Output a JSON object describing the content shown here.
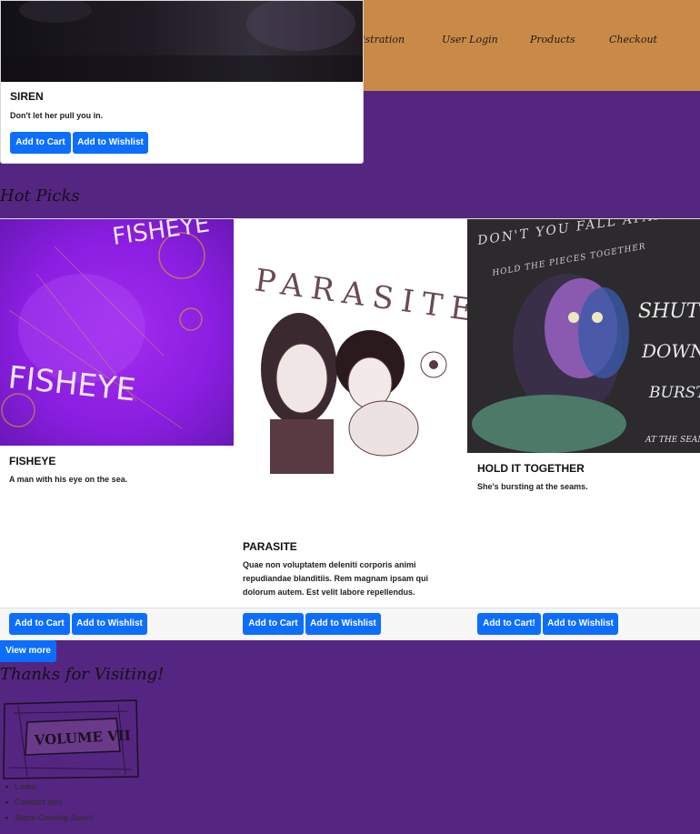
{
  "nav": {
    "links": [
      "istration",
      "User Login",
      "Products",
      "Checkout"
    ]
  },
  "featured": {
    "title": "SIREN",
    "text": "Don't let her pull you in.",
    "cart_label": "Add to Cart",
    "wishlist_label": "Add to Wishlist"
  },
  "hot_picks": {
    "heading": "Hot Picks",
    "cards": [
      {
        "title": "FISHEYE",
        "art_words": [
          "FISHEYE",
          "FISHEYE"
        ],
        "text": "A man with his eye on the sea.",
        "cart_label": "Add to Cart",
        "wishlist_label": "Add to Wishlist"
      },
      {
        "title": "PARASITE",
        "art_words": [
          "PARASITES"
        ],
        "text": "Quae non voluptatem deleniti corporis animi repudiandae blanditiis. Rem magnam ipsam qui dolorum autem. Est velit labore repellendus.",
        "cart_label": "Add to Cart",
        "wishlist_label": "Add to Wishlist"
      },
      {
        "title": "HOLD IT TOGETHER",
        "art_words": [
          "DON'T YOU FALL APART",
          "HOLD THE PIECES TOGETHER",
          "SHUT",
          "DOWN",
          "BURST",
          "AT THE SEAMS"
        ],
        "text": "She's bursting at the seams.",
        "cart_label": "Add to Cart!",
        "wishlist_label": "Add to Wishlist"
      }
    ],
    "view_more_label": "View more"
  },
  "thanks": {
    "heading": "Thanks for Visiting!",
    "logo_text": "VOLUME VII"
  },
  "footer_links": [
    "Links",
    "Contact Info",
    "Store Coming Soon!"
  ],
  "colors": {
    "page_bg": "#542681",
    "nav_bg": "#c98a48",
    "button": "#0d6efd"
  }
}
